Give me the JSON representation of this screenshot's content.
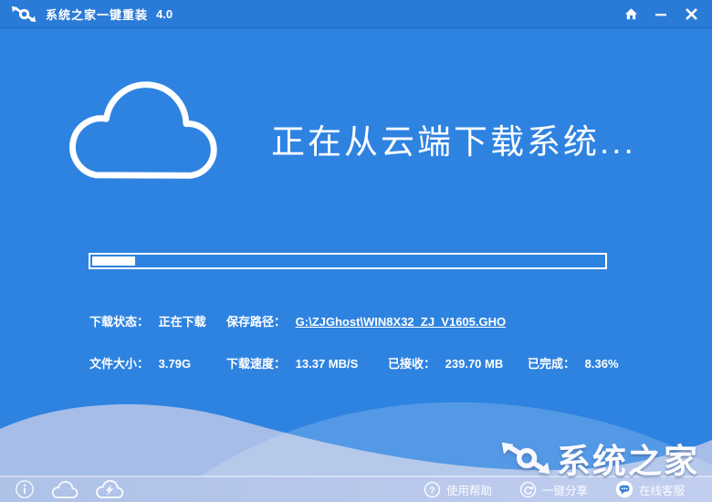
{
  "titlebar": {
    "title": "系统之家一键重装",
    "version": "4.0"
  },
  "main": {
    "heading": "正在从云端下载系统...",
    "progress_percent": 8.36,
    "fields": {
      "status_label": "下载状态：",
      "status_value": "正在下载",
      "path_label": "保存路径：",
      "path_value": "G:\\ZJGhost\\WIN8X32_ZJ_V1605.GHO",
      "size_label": "文件大小：",
      "size_value": "3.79G",
      "speed_label": "下载速度：",
      "speed_value": "13.37 MB/S",
      "received_label": "已接收：",
      "received_value": "239.70 MB",
      "completed_label": "已完成：",
      "completed_value": "8.36%"
    }
  },
  "footer": {
    "help_label": "使用帮助",
    "share_label": "一键分享",
    "support_label": "在线客服"
  },
  "watermark": {
    "text": "系统之家"
  },
  "colors": {
    "background": "#2e83e1",
    "titlebar": "#2a7bd7",
    "wave_light": "#a5bde7",
    "footer_strip_left": "#aec1e7",
    "footer_strip_right": "#c1ceef",
    "white": "#ffffff"
  }
}
